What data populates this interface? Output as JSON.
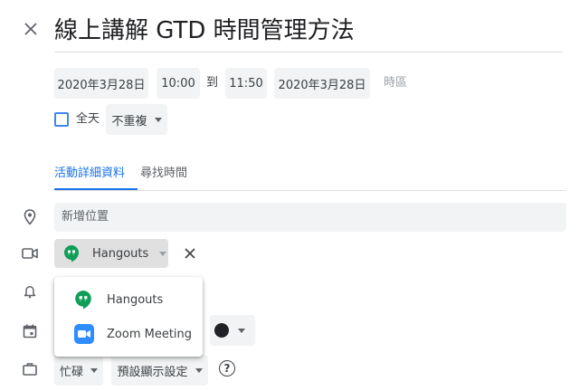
{
  "event": {
    "title": "線上講解 GTD 時間管理方法",
    "start_date": "2020年3月28日",
    "start_time": "10:00",
    "to_label": "到",
    "end_time": "11:50",
    "end_date": "2020年3月28日",
    "timezone_label": "時區",
    "all_day_label": "全天",
    "all_day_checked": false,
    "repeat_value": "不重複"
  },
  "tabs": [
    {
      "label": "活動詳細資料",
      "active": true
    },
    {
      "label": "尋找時間",
      "active": false
    }
  ],
  "location": {
    "placeholder": "新增位置"
  },
  "conference": {
    "selected": "Hangouts",
    "options": [
      {
        "label": "Hangouts",
        "icon": "hangouts-icon"
      },
      {
        "label": "Zoom Meeting",
        "icon": "zoom-icon"
      }
    ]
  },
  "availability": {
    "value": "忙碌",
    "visibility": "預設顯示設定"
  },
  "colors": {
    "accent": "#1a73e8",
    "checkbox": "#4285f4",
    "hangouts_green": "#0f9d58",
    "zoom_blue": "#2d8cff",
    "event_color": "#202124"
  },
  "icons": {
    "close": "close-icon",
    "location": "location-pin-icon",
    "video": "video-camera-icon",
    "notification": "bell-icon",
    "calendar": "calendar-icon",
    "busy": "briefcase-icon",
    "help": "help-icon"
  }
}
